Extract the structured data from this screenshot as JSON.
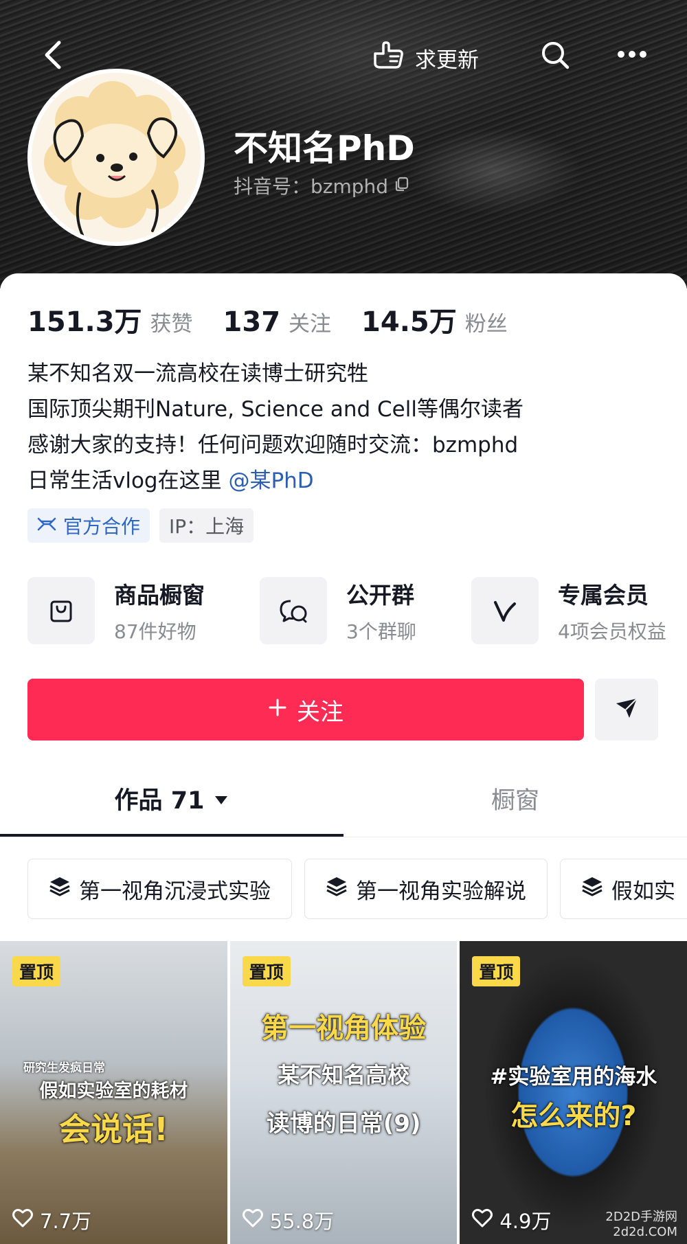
{
  "header": {
    "request_update_label": "求更新"
  },
  "profile": {
    "name": "不知名PhD",
    "douyin_id": "抖音号：bzmphd"
  },
  "stats": [
    {
      "value": "151.3万",
      "label": "获赞"
    },
    {
      "value": "137",
      "label": "关注"
    },
    {
      "value": "14.5万",
      "label": "粉丝"
    }
  ],
  "bio": {
    "line1": "某不知名双一流高校在读博士研究牲",
    "line2": "国际顶尖期刊Nature, Science and Cell等偶尔读者",
    "line3": "感谢大家的支持！任何问题欢迎随时交流：bzmphd",
    "line4_prefix": "日常生活vlog在这里",
    "line4_mention": "@某PhD"
  },
  "tags": {
    "official": "官方合作",
    "ip": "IP：上海"
  },
  "services": [
    {
      "title": "商品橱窗",
      "sub": "87件好物"
    },
    {
      "title": "公开群",
      "sub": "3个群聊"
    },
    {
      "title": "专属会员",
      "sub": "4项会员权益"
    }
  ],
  "follow_button": "关注",
  "tabs": {
    "works": "作品 71",
    "window": "橱窗"
  },
  "collections": [
    "第一视角沉浸式实验",
    "第一视角实验解说",
    "假如实"
  ],
  "videos": [
    {
      "pin": "置顶",
      "caption_small": "研究生发疯日常",
      "caption_a": "假如实验室的耗材",
      "caption_b": "会说话!",
      "likes": "7.7万"
    },
    {
      "pin": "置顶",
      "caption_a": "第一视角体验",
      "caption_b": "某不知名高校",
      "caption_c": "读博的日常(9)",
      "likes": "55.8万"
    },
    {
      "pin": "置顶",
      "caption_a": "#实验室用的海水",
      "caption_b": "怎么来的?",
      "likes": "4.9万"
    }
  ],
  "watermark": {
    "line1": "2D2D手游网",
    "line2": "2d2d.COM"
  },
  "colors": {
    "follow": "#fe2c55",
    "mention": "#2b5db3",
    "pin_badge": "#f9d94a"
  }
}
